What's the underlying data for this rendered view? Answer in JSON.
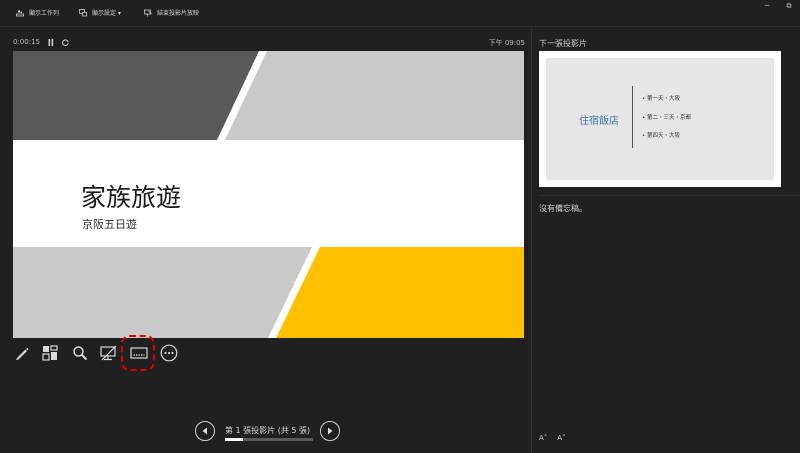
{
  "toolbar": {
    "taskbar_label": "顯示工作列",
    "display_settings_label": "顯示設定 ▾",
    "end_show_label": "結束投影片放映"
  },
  "window": {
    "minimize": "─",
    "restore": "⧉"
  },
  "timer": {
    "elapsed": "0:00:15",
    "clock": "下午 09:05"
  },
  "current_slide": {
    "title": "家族旅遊",
    "subtitle": "京阪五日遊"
  },
  "next_slide": {
    "label": "下一張投影片",
    "title": "住宿飯店",
    "bullets": [
      "• 第一天・大阪",
      "• 第二・三天・京都",
      "• 第四天・大阪"
    ]
  },
  "notes": {
    "text": "沒有備忘稿。"
  },
  "navigation": {
    "label": "第 1 張投影片 (共 5 張)",
    "current": 1,
    "total": 5
  },
  "font_controls": {
    "increase": "A˄",
    "decrease": "A˅"
  },
  "colors": {
    "background": "#202020",
    "accent_yellow": "#FFC000",
    "dark_gray": "#595959",
    "light_gray": "#C9C9C9",
    "annotation_red": "#E00000"
  }
}
